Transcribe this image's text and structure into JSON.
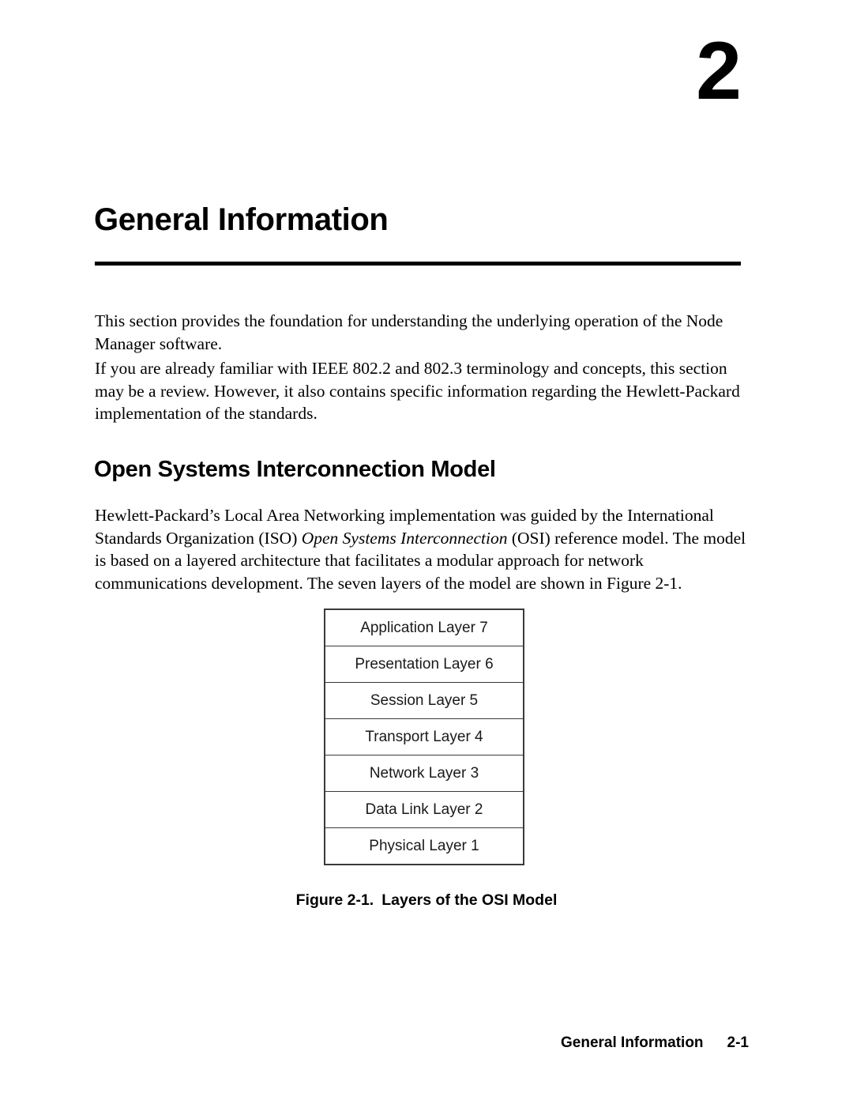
{
  "chapter": {
    "number": "2",
    "title": "General Information"
  },
  "intro": {
    "paragraph_1": "This section provides the foundation for understanding the underlying operation of the Node Manager software.",
    "paragraph_2": "If you are already familiar with IEEE 802.2 and 802.3 terminology and concepts, this section may be a review.  However, it also contains specific information regarding the Hewlett-Packard implementation of the standards."
  },
  "section": {
    "heading": "Open Systems Interconnection Model",
    "paragraph_parts": {
      "before_italic": "Hewlett-Packard’s Local Area Networking implementation was guided by the International Standards Organization (ISO) ",
      "italic": "Open Systems Interconnection",
      "after_italic": " (OSI) reference model.  The model is based on a layered architecture that facilitates a modular approach for network communications development.  The seven layers of the model are shown in Figure 2-1."
    }
  },
  "figure": {
    "layers": [
      "Application Layer 7",
      "Presentation Layer 6",
      "Session Layer 5",
      "Transport Layer 4",
      "Network Layer 3",
      "Data Link Layer 2",
      "Physical Layer 1"
    ],
    "caption_label": "Figure 2-1.",
    "caption_text": "Layers of the OSI Model"
  },
  "footer": {
    "chapter_name": "General Information",
    "page_number": "2-1"
  }
}
